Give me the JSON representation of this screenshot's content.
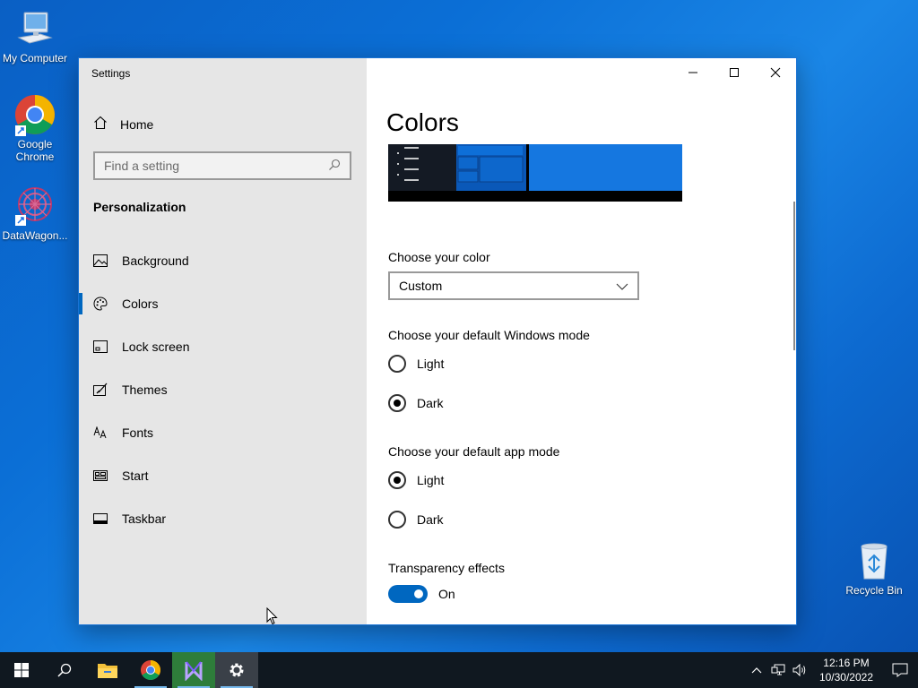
{
  "desktop": {
    "icons": [
      {
        "label": "My Computer"
      },
      {
        "label": "Google Chrome"
      },
      {
        "label": "DataWagon..."
      },
      {
        "label": "Recycle Bin"
      }
    ]
  },
  "window": {
    "title": "Settings",
    "nav": {
      "home_label": "Home",
      "search_placeholder": "Find a setting",
      "section_title": "Personalization",
      "items": [
        {
          "label": "Background",
          "icon": "picture-icon"
        },
        {
          "label": "Colors",
          "icon": "palette-icon"
        },
        {
          "label": "Lock screen",
          "icon": "lock-screen-icon"
        },
        {
          "label": "Themes",
          "icon": "themes-icon"
        },
        {
          "label": "Fonts",
          "icon": "fonts-icon"
        },
        {
          "label": "Start",
          "icon": "start-icon"
        },
        {
          "label": "Taskbar",
          "icon": "taskbar-icon"
        }
      ],
      "active_item": "Colors"
    },
    "content": {
      "title": "Colors",
      "choose_color_label": "Choose your color",
      "choose_color_value": "Custom",
      "windows_mode_label": "Choose your default Windows mode",
      "windows_mode_options": [
        "Light",
        "Dark"
      ],
      "windows_mode_selected": "Dark",
      "app_mode_label": "Choose your default app mode",
      "app_mode_options": [
        "Light",
        "Dark"
      ],
      "app_mode_selected": "Light",
      "transparency_label": "Transparency effects",
      "transparency_state": "On"
    }
  },
  "taskbar": {
    "time": "12:16 PM",
    "date": "10/30/2022"
  },
  "colors": {
    "accent": "#0067c0",
    "taskbar_bg": "#101820",
    "nav_bg": "#e6e6e6"
  }
}
